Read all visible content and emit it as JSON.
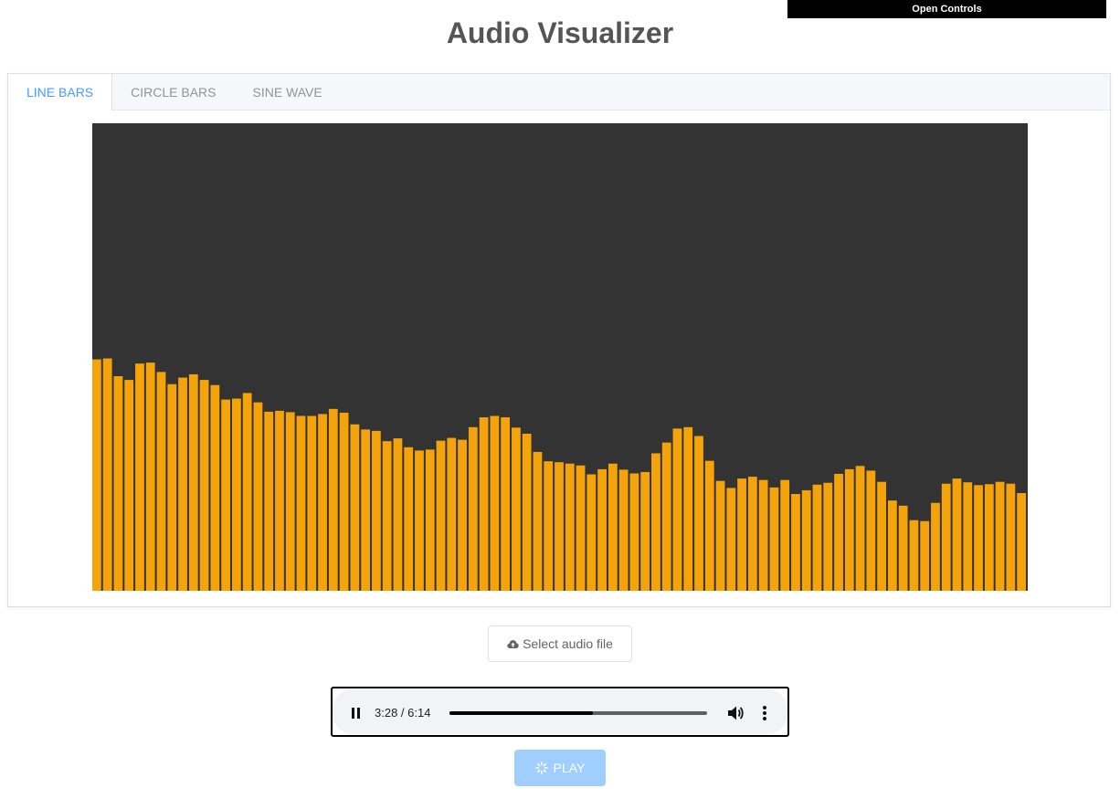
{
  "header": {
    "open_controls_label": "Open Controls",
    "title": "Audio Visualizer"
  },
  "tabs": [
    {
      "label": "LINE BARS",
      "active": true
    },
    {
      "label": "CIRCLE BARS",
      "active": false
    },
    {
      "label": "SINE WAVE",
      "active": false
    }
  ],
  "visualizer": {
    "background_color": "#333333",
    "bar_color": "#f5a30a",
    "bar_levels": [
      0.495,
      0.497,
      0.459,
      0.451,
      0.486,
      0.488,
      0.468,
      0.442,
      0.456,
      0.463,
      0.451,
      0.44,
      0.409,
      0.411,
      0.423,
      0.403,
      0.383,
      0.385,
      0.382,
      0.374,
      0.374,
      0.378,
      0.389,
      0.381,
      0.356,
      0.345,
      0.342,
      0.32,
      0.326,
      0.307,
      0.3,
      0.302,
      0.321,
      0.327,
      0.323,
      0.35,
      0.371,
      0.374,
      0.371,
      0.349,
      0.336,
      0.297,
      0.277,
      0.275,
      0.272,
      0.268,
      0.249,
      0.26,
      0.272,
      0.259,
      0.251,
      0.254,
      0.294,
      0.317,
      0.347,
      0.35,
      0.331,
      0.278,
      0.235,
      0.22,
      0.24,
      0.244,
      0.237,
      0.221,
      0.237,
      0.207,
      0.215,
      0.227,
      0.231,
      0.25,
      0.26,
      0.267,
      0.257,
      0.233,
      0.193,
      0.182,
      0.151,
      0.149,
      0.188,
      0.229,
      0.24,
      0.232,
      0.226,
      0.228,
      0.233,
      0.229,
      0.209
    ]
  },
  "upload": {
    "label": "Select audio file",
    "icon": "cloud-upload-icon"
  },
  "audio_player": {
    "time_text": "3:28 / 6:14",
    "progress": 0.556,
    "state": "playing",
    "icons": [
      "pause-icon",
      "volume-icon",
      "more-options-icon"
    ]
  },
  "play_button": {
    "label": "PLAY",
    "icon": "loading-icon",
    "disabled": true,
    "color": "#a0cfff"
  }
}
